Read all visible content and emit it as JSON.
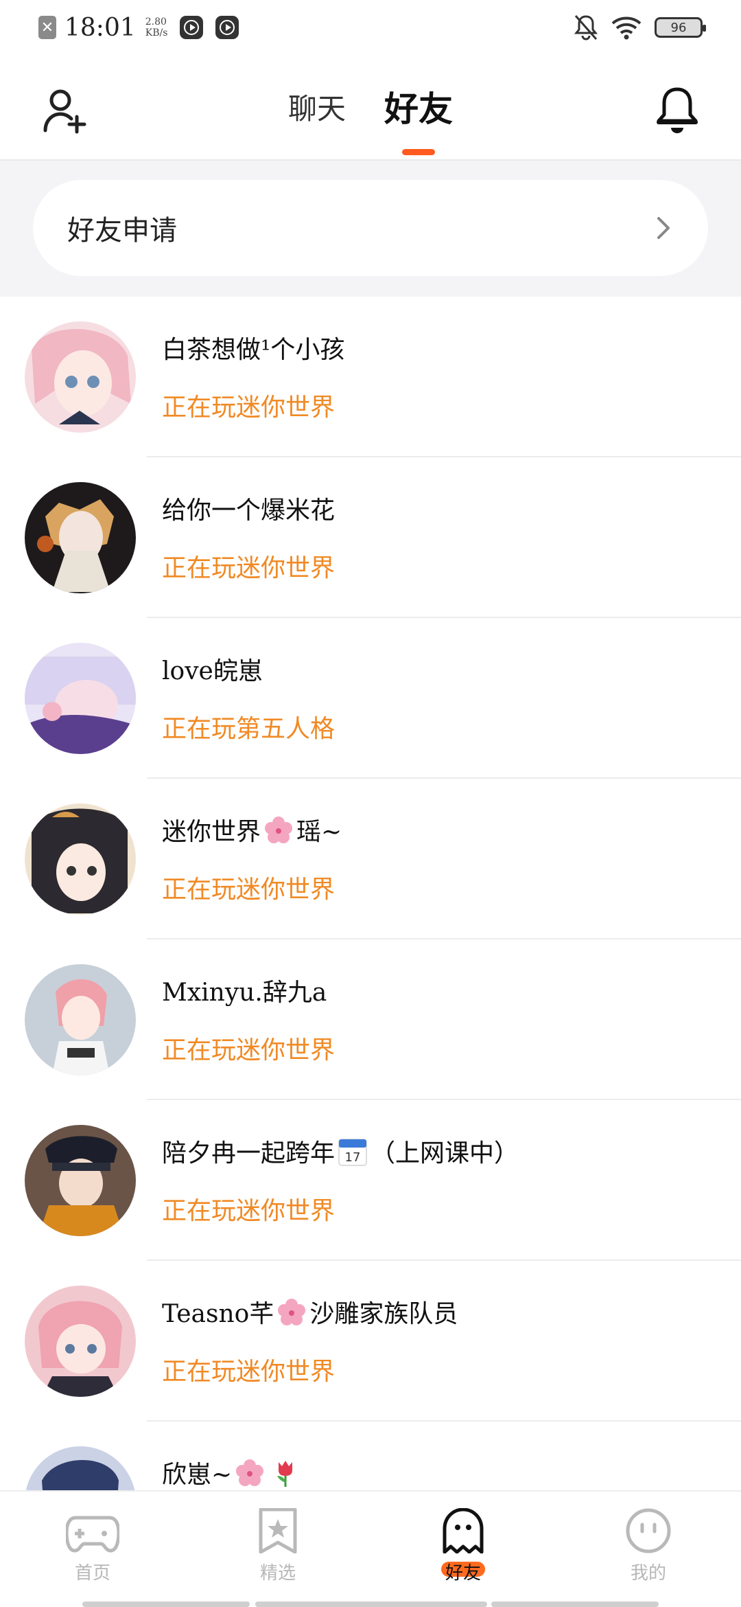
{
  "status_bar": {
    "time": "18:01",
    "speed_value": "2.80",
    "speed_unit": "KB/s",
    "battery": "96"
  },
  "header": {
    "tabs": [
      {
        "label": "聊天",
        "active": false
      },
      {
        "label": "好友",
        "active": true
      }
    ]
  },
  "friend_request": {
    "label": "好友申请"
  },
  "friends": [
    {
      "name": "白茶想做¹个小孩",
      "status": "正在玩迷你世界"
    },
    {
      "name": "给你一个爆米花",
      "status": "正在玩迷你世界"
    },
    {
      "name": "love皖崽",
      "status": "正在玩第五人格"
    },
    {
      "name_parts": [
        "迷你世界",
        "瑶~"
      ],
      "status": "正在玩迷你世界"
    },
    {
      "name": "Mxinyu.辞九a",
      "status": "正在玩迷你世界"
    },
    {
      "name_parts": [
        "陪夕冉一起跨年",
        "（上网课中）"
      ],
      "status": "正在玩迷你世界"
    },
    {
      "name_parts": [
        "Teasno芊",
        "沙雕家族队员"
      ],
      "status": "正在玩迷你世界"
    },
    {
      "name": "欣崽~",
      "status": ""
    }
  ],
  "bottom_nav": [
    {
      "label": "首页",
      "icon": "gamepad-icon",
      "active": false
    },
    {
      "label": "精选",
      "icon": "star-bookmark-icon",
      "active": false
    },
    {
      "label": "好友",
      "icon": "ghost-icon",
      "active": true
    },
    {
      "label": "我的",
      "icon": "smiley-icon",
      "active": false
    }
  ],
  "colors": {
    "accent": "#ff5a1f",
    "status_text": "#f08a25"
  }
}
